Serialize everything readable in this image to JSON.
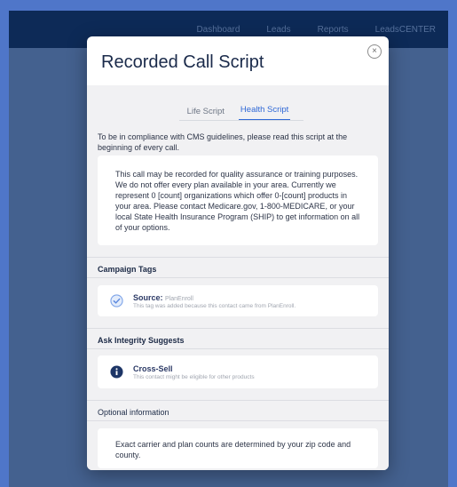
{
  "nav": {
    "items": [
      "Dashboard",
      "Leads",
      "Reports",
      "LeadsCENTER"
    ]
  },
  "modal": {
    "title": "Recorded Call Script",
    "close_glyph": "×",
    "tabs": [
      {
        "label": "Life Script",
        "active": false
      },
      {
        "label": "Health Script",
        "active": true
      }
    ],
    "intro": "To be in compliance with CMS guidelines, please read this script at the beginning of every call.",
    "script_text": "This call may be recorded for quality assurance or training purposes. We do not offer every plan available in your area. Currently we represent 0 [count] organizations which offer 0-[count] products in your area. Please contact Medicare.gov, 1-800-MEDICARE, or your local State Health Insurance Program (SHIP) to get information on all of your options.",
    "campaign_tags": {
      "title": "Campaign Tags",
      "label": "Source:",
      "value": "PlanEnroll",
      "description": "This tag was added because this contact came from PlanEnroll."
    },
    "suggestions": {
      "title": "Ask Integrity Suggests",
      "label": "Cross-Sell",
      "description": "This contact might be eligible for other products"
    },
    "optional": {
      "title": "Optional information",
      "text": "Exact carrier and plan counts are determined by your zip code and county."
    }
  },
  "colors": {
    "accent": "#2f68d6",
    "topbar": "#0d2a57",
    "backdrop": "#44618f",
    "icon_dark": "#1d3566"
  },
  "icons": {
    "close": "close-icon",
    "source": "check-circle-icon",
    "suggestion": "info-circle-icon"
  }
}
